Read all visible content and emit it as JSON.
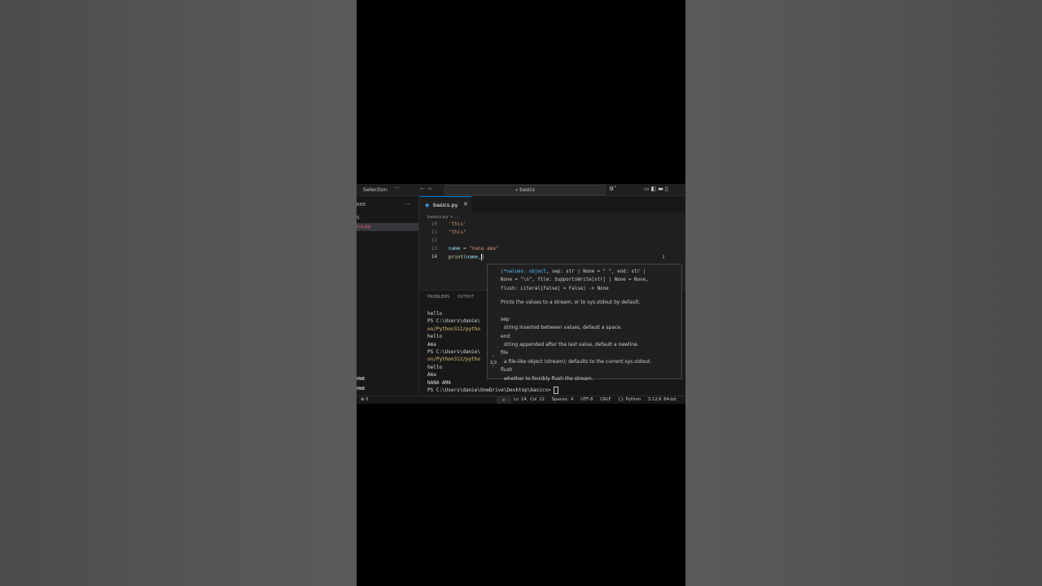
{
  "titlebar": {
    "menu_label": "Selection",
    "more": "···",
    "nav_back": "←",
    "nav_forward": "→",
    "search_text": "basics",
    "copilot": "⚙˅",
    "layout_icons": "▭◧▬▯"
  },
  "sidebar": {
    "header": "RER",
    "more": "···",
    "section": "S",
    "file": "ics.py",
    "outline1": "INE",
    "outline2": "INE"
  },
  "tab": {
    "label": "basics.py",
    "close": "✕"
  },
  "breadcrumb": "basics.py > ...",
  "code": {
    "lines": [
      {
        "num": "10",
        "text": "'this'"
      },
      {
        "num": "11",
        "text": "\"this\""
      },
      {
        "num": "12",
        "text": ""
      },
      {
        "num": "13",
        "var": "name",
        "op": " = ",
        "str": "\"nana ama\""
      },
      {
        "num": "14",
        "fn": "print",
        "args": "(name,"
      }
    ]
  },
  "panel": {
    "tabs": "PROBLEMS OUTPUT",
    "terminal": [
      "hello",
      "PS C:\\Users\\danie\\",
      "on/Python312/pytho",
      "hello",
      "Ama",
      "PS C:\\Users\\danie\\",
      "on/Python312/pytho",
      "hello",
      "Ama",
      "NANA AMA",
      "PS C:\\Users\\danie\\OneDrive\\Desktop\\basics>"
    ]
  },
  "hover": {
    "signature": [
      "(*values: object, sep: str | None = \" \", end: str |",
      "None = \"\\n\", file: SupportsWrite[str] | None = None,",
      "flush: Literal[False] = False) -> None"
    ],
    "signature_highlight": "*values: object",
    "doc": [
      {
        "text": "Prints the values to a stream, or to sys.stdout by default.",
        "indent": false
      },
      {
        "text": "",
        "indent": false
      },
      {
        "text": "sep",
        "indent": false
      },
      {
        "text": "string inserted between values, default a space.",
        "indent": true
      },
      {
        "text": "end",
        "indent": false
      },
      {
        "text": "string appended after the last value, default a newline.",
        "indent": true
      },
      {
        "text": "file",
        "indent": false
      },
      {
        "text": "a file-like object (stream); defaults to the current sys.stdout.",
        "indent": true
      },
      {
        "text": "flush",
        "indent": false
      },
      {
        "text": "whether to forcibly flush the stream.",
        "indent": true
      }
    ],
    "counter_up": "˄",
    "counter": "1/2",
    "counter_down": "˅"
  },
  "statusbar": {
    "left": "⊗ 0",
    "zoom_icon": "🔍",
    "position": "Ln 14, Col 12",
    "spaces": "Spaces: 4",
    "encoding": "UTF-8",
    "eol": "CRLF",
    "language": "{} Python",
    "interpreter": "3.12.6 64-bit"
  },
  "colors": {
    "accent": "#0078d4",
    "string": "#ce9178",
    "variable": "#9cdcfe",
    "function": "#dcdcaa"
  }
}
